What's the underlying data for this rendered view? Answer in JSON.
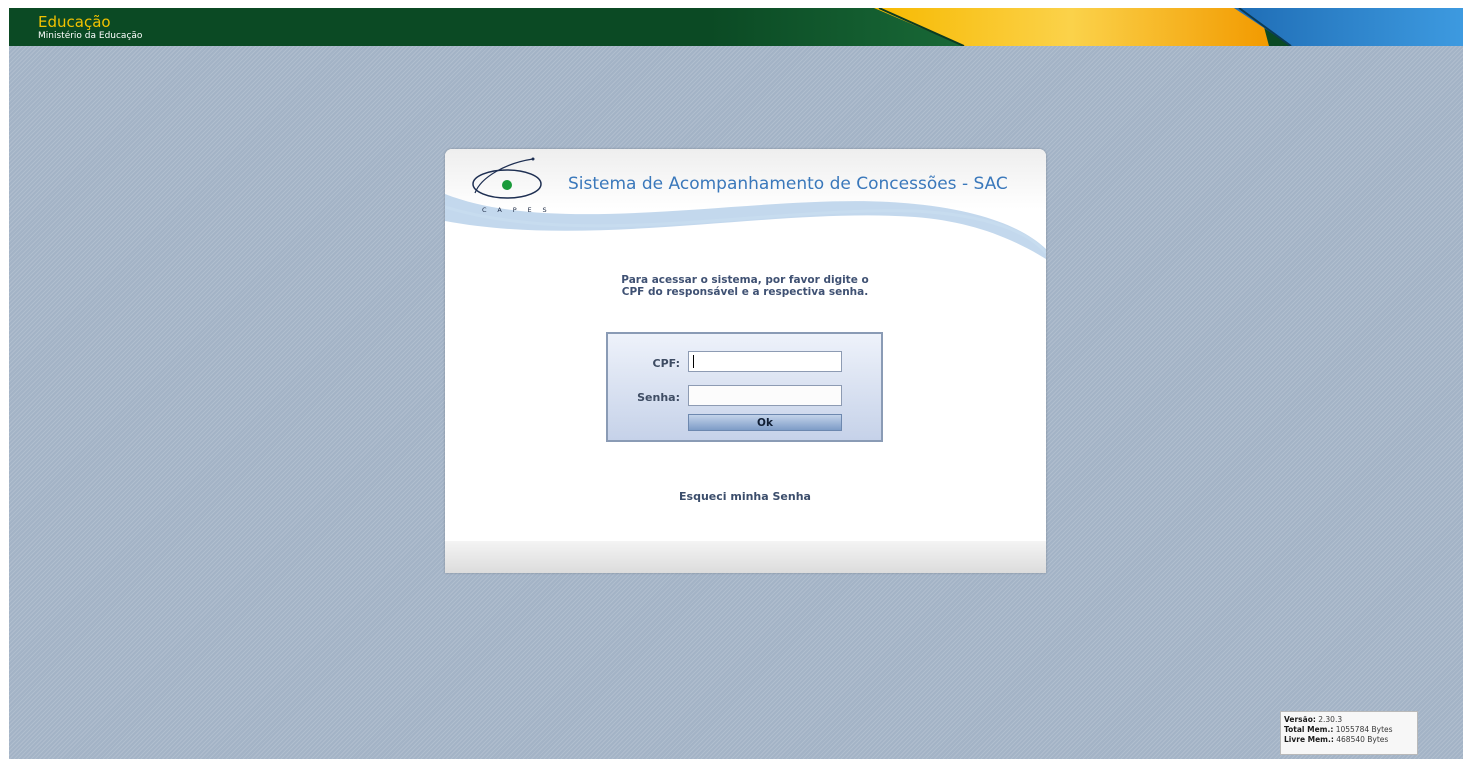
{
  "banner": {
    "title": "Educação",
    "subtitle": "Ministério da Educação"
  },
  "card": {
    "logo_text": "C A P E S",
    "system_title": "Sistema de Acompanhamento de Concessões - SAC",
    "instructions_line1": "Para acessar o sistema, por favor digite o",
    "instructions_line2": "CPF do responsável e a respectiva senha."
  },
  "form": {
    "cpf_label": "CPF:",
    "cpf_value": "",
    "senha_label": "Senha:",
    "senha_value": "",
    "ok_label": "Ok"
  },
  "links": {
    "forgot_password": "Esqueci minha Senha"
  },
  "footer": {
    "version_label": "Versão:",
    "version_value": "2.30.3",
    "total_mem_label": "Total Mem.:",
    "total_mem_value": "1055784 Bytes",
    "free_mem_label": "Livre Mem.:",
    "free_mem_value": "468540 Bytes"
  },
  "colors": {
    "banner_green": "#0b4a24",
    "title_blue": "#3a78bb",
    "background": "#a3b3c6"
  }
}
